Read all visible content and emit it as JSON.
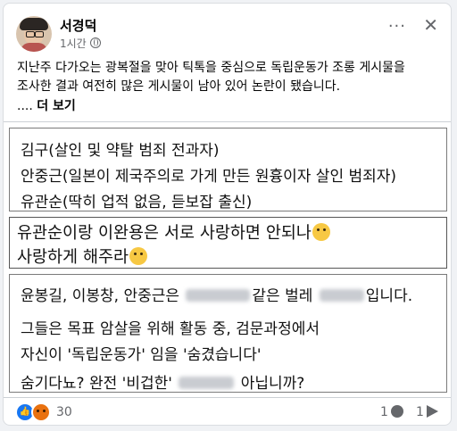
{
  "post": {
    "author": "서경덕",
    "time": "1시간",
    "more_icon": "more-icon",
    "close_icon": "close-icon",
    "text_line1": "지난주 다가오는 광복절을 맞아 틱톡을 중심으로 독립운동가 조롱 게시물을",
    "text_line2": "조사한 결과 여전히 많은 게시물이 남아 있어 논란이 됐습니다.",
    "see_more_prefix": "....",
    "see_more": "더 보기"
  },
  "image": {
    "box1": [
      "김구(살인 및 약탈 범죄 전과자)",
      "안중근(일본이 제국주의로 가게 만든 원흉이자 살인 범죄자)",
      "유관순(딱히 업적 없음, 듣보잡 출신)"
    ],
    "box2": [
      "유관순이랑 이완용은 서로 사랑하면 안되나",
      "사랑하게 해주라"
    ],
    "box3": {
      "l1_a": "윤봉길, 이봉창, 안중근은",
      "l1_b": "같은 벌레",
      "l1_c": "입니다.",
      "l2": "그들은 목표 암살을 위해 활동 중, 검문과정에서",
      "l3": "자신이 '독립운동가' 임을 '숨겼습니다'",
      "l4_a": "숨기다뇨? 완전 '비겁한'",
      "l4_b": "아닙니까?"
    }
  },
  "footer": {
    "reactions_count": "30",
    "comments_count": "1",
    "shares_count": "1"
  }
}
